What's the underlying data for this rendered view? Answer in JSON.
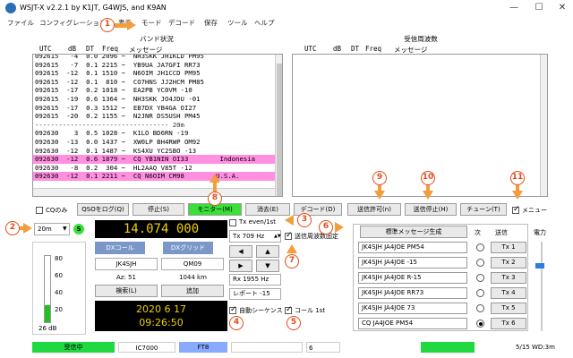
{
  "window": {
    "title": "WSJT-X   v2.2.1   by K1JT, G4WJS, and K9AN",
    "min": "—",
    "max": "☐",
    "close": "✕"
  },
  "menu": [
    "ファイル",
    "コンフィグレーション",
    "表示",
    "モード",
    "デコード",
    "保存",
    "ツール",
    "ヘルプ"
  ],
  "band_activity": {
    "title": "バンド状況",
    "headers": {
      "utc": "UTC",
      "db": "dB",
      "dt": "DT",
      "freq": "Freq",
      "msg": "メッセージ"
    },
    "rows": [
      {
        "text": "092615   -4  0.0 2096 ~  NH3SKK JH1KLD PM95",
        "cq": false
      },
      {
        "text": "092615   -7  0.1 2215 ~  YB9UA JA7GFI RR73",
        "cq": false
      },
      {
        "text": "092615  -12  0.1 1510 ~  N6OIM JH1CCD PM95",
        "cq": false
      },
      {
        "text": "092615  -12  0.1  810 ~  CO7HNS JJ2HCM PM85",
        "cq": false
      },
      {
        "text": "092615  -17  0.2 1018 ~  EA2PB YC0VM -10",
        "cq": false
      },
      {
        "text": "092615  -19  0.6 1364 ~  NH3SKK JO4JDU -01",
        "cq": false
      },
      {
        "text": "092615  -17  0.3 1512 ~  EB7DX YB4GA OI27",
        "cq": false
      },
      {
        "text": "092615  -20  0.2 1155 ~  N2JNR DS5USH PM45",
        "cq": false
      },
      {
        "text": "---------------------------------- 20m",
        "cq": false,
        "sep": true
      },
      {
        "text": "092630    3  0.5 1028 ~  K1LO BD6RN -19",
        "cq": false
      },
      {
        "text": "092630  -13  0.0 1437 ~  XW0LP BH4RWP OM92",
        "cq": false
      },
      {
        "text": "092630  -12  0.1 1487 ~  KS4XU YC2SBO -13",
        "cq": false
      },
      {
        "text": "092630  -12  0.6 1879 ~  CQ YB1NIN OI33        Indonesia",
        "cq": true
      },
      {
        "text": "092630   -8  0.2  304 ~  HL2AAQ V85T -12",
        "cq": false
      },
      {
        "text": "092630  -12  0.1 2211 ~  CQ N6OIM CM98        U.S.A.",
        "cq": true
      }
    ]
  },
  "rx_frequency": {
    "title": "受信周波数",
    "headers": {
      "utc": "UTC",
      "db": "dB",
      "dt": "DT",
      "freq": "Freq",
      "msg": "メッセージ"
    }
  },
  "controls": {
    "cq_only": "CQのみ",
    "log_qso": "QSOをログ(Q)",
    "stop": "停止(S)",
    "monitor": "モニター(M)",
    "erase": "消去(E)",
    "decode": "デコード(D)",
    "enable_tx": "送信許可(n)",
    "halt_tx": "送信停止(H)",
    "tune": "チューン(T)",
    "menus": "メニュー"
  },
  "band": {
    "value": "20m",
    "s": "S"
  },
  "frequency": "14.074 000",
  "tx_even": "Tx even/1st",
  "tx_hz": "Tx  709  Hz",
  "hold_tx": "送信周波数固定",
  "rx_hz": "Rx  1955  Hz",
  "report": "レポート -15",
  "auto_seq": "自動シーケンス",
  "call_1st": "コール 1st",
  "dx": {
    "call_label": "DXコール",
    "grid_label": "DXグリッド",
    "call": "JK4SJH",
    "grid": "QM09",
    "az": "Az: 51",
    "dist": "1044 km",
    "lookup": "検索(L)",
    "add": "追加"
  },
  "clock": {
    "date": "2020 6 17",
    "time": "09:26:50"
  },
  "meter": {
    "ticks": [
      "80",
      "60",
      "40",
      "20"
    ],
    "db": "26 dB",
    "level": 0.26
  },
  "tx_panel": {
    "gen": "標準メッセージ生成",
    "next": "次",
    "now": "送信",
    "power": "電力",
    "messages": [
      {
        "text": "JK4SJH JA4JOE PM54",
        "btn": "Tx 1",
        "on": false
      },
      {
        "text": "JK4SJH JA4JOE -15",
        "btn": "Tx 2",
        "on": false
      },
      {
        "text": "JK4SJH JA4JOE R-15",
        "btn": "Tx 3",
        "on": false
      },
      {
        "text": "JK4SJH JA4JOE RR73",
        "btn": "Tx 4",
        "on": false
      },
      {
        "text": "JK4SJH JA4JOE 73",
        "btn": "Tx 5",
        "on": false
      },
      {
        "text": "CQ JA4JOE PM54",
        "btn": "Tx 6",
        "on": true
      }
    ]
  },
  "status": {
    "rx": "受信中",
    "rig": "IC7000",
    "mode": "FT8",
    "six": "6",
    "right": "5/15  WD:3m"
  },
  "callouts": [
    "1",
    "2",
    "3",
    "4",
    "5",
    "6",
    "7",
    "8",
    "9",
    "10",
    "11"
  ],
  "colors": {
    "monitor": "#38e038",
    "cq_row": "#ff8fe0",
    "accent": "#e54a1a",
    "arrow": "#f39d3d",
    "clock_text": "#f0d000",
    "status_rx": "#20d840"
  }
}
